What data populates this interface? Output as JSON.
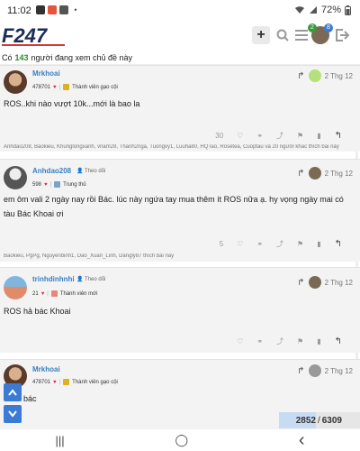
{
  "status": {
    "time": "11:02",
    "battery": "72%"
  },
  "header": {
    "logo": "F247",
    "plus": "+",
    "avatar_badge_green": "2",
    "avatar_badge_blue": "8"
  },
  "online": {
    "prefix": "Có",
    "count": "143",
    "suffix": "người đang xem chủ đề này"
  },
  "posts": [
    {
      "username": "Mrkhoai",
      "follow": "",
      "score": "478701",
      "rank": "Thành viên gạo cội",
      "date": "2 Thg 12",
      "content": "ROS..khi nào vượt 10k...mới là bao la",
      "likes": "30",
      "likers": "Anhdao208, Baokieu, Khunglongxanh, vnam28, Thanh2nga, Tuongvy1, Luuha80, HQTao, Rosetea, Cuoptau và 20 người khác thích bài này"
    },
    {
      "username": "Anhdao208",
      "follow": "Theo dõi",
      "score": "598",
      "rank": "Trung thủ",
      "date": "2 Thg 12",
      "content": "em ôm vali 2 ngày nay rồi Bác. lúc này ngứa tay mua thêm ít ROS nữa ạ. hy vọng ngày mai có tàu Bác Khoai ơi",
      "likes": "5",
      "likers": "Baokieu, PgPg, Nguyenbinh1, Dao_Xuan_Linh, Dangly87 thích bài này"
    },
    {
      "username": "trinhdinhnhi",
      "follow": "Theo dõi",
      "score": "21",
      "rank": "Thành viên mới",
      "date": "2 Thg 12",
      "content": "ROS hả bác Khoai",
      "likes": "",
      "likers": ""
    },
    {
      "username": "Mrkhoai",
      "follow": "",
      "score": "478701",
      "rank": "Thành viên gạo cội",
      "date": "2 Thg 12",
      "content": "bác",
      "likes": "",
      "likers": ""
    }
  ],
  "progress": {
    "current": "2852",
    "separator": "/",
    "total": "6309",
    "fraction": 0.452
  },
  "navbar": {
    "recent": "|||",
    "home": "◯",
    "back": "‹"
  },
  "colors": {
    "accent": "#3b7bd6",
    "username": "#3a7fc1",
    "online_count": "#2e8b2e",
    "heart": "#e22244"
  }
}
